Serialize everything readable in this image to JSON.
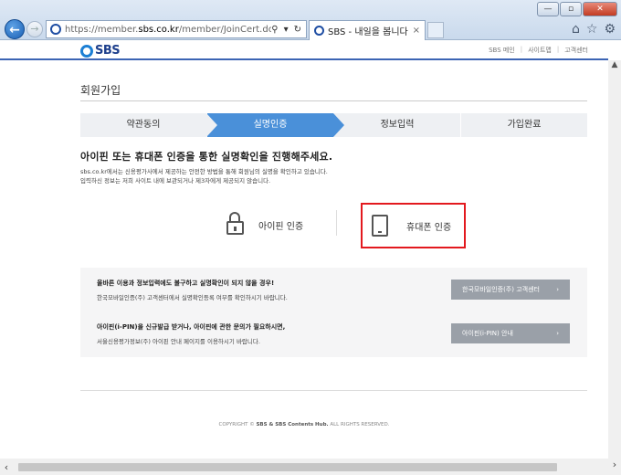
{
  "browser": {
    "url_prefix": "https://member.",
    "url_domain": "sbs.co.kr",
    "url_path": "/member/JoinCert.do",
    "tab_title": "SBS - 내일을 봅니다",
    "tab_close": "×",
    "search_symbol": "⚲",
    "dropdown_symbol": "▾",
    "refresh_symbol": "↻",
    "back_symbol": "←",
    "forward_symbol": "→",
    "home_symbol": "⌂",
    "star_symbol": "☆",
    "gear_symbol": "⚙",
    "minimize_symbol": "—",
    "maximize_symbol": "▫",
    "close_symbol": "✕"
  },
  "site": {
    "logo_text": "SBS",
    "links": [
      "SBS 메인",
      "사이트맵",
      "고객센터"
    ],
    "link_sep": "|"
  },
  "page": {
    "title": "회원가입",
    "steps": [
      "약관동의",
      "실명인증",
      "정보입력",
      "가입완료"
    ],
    "heading": "아이핀 또는 휴대폰 인증을 통한 실명확인을 진행해주세요.",
    "desc1": "sbs.co.kr에서는 신용평가사에서 제공하는 안전한 방법을 통해 회원님의 실명을 확인하고 있습니다.",
    "desc2": "입력하신 정보는 저희 사이트 내에 보관되거나 제3자에게 제공되지 않습니다.",
    "methods": {
      "ipin": "아이핀 인증",
      "phone": "휴대폰 인증"
    }
  },
  "info": {
    "row1_title": "올바른 이용과 정보입력에도 불구하고 실명확인이 되지 않을 경우!",
    "row1_text": "한국모바일인증(주) 고객센터에서 실명확인등록 여부를 확인하시기 바랍니다.",
    "row1_btn": "한국모바일인증(주) 고객센터",
    "row2_title": "아이핀(i-PIN)을 신규발급 받거나, 아이핀에 관한 문의가 필요하시면,",
    "row2_text": "서울신용평가정보(주) 아이핀 안내 페이지를 이용하시기 바랍니다.",
    "row2_btn": "아이핀(i-PIN) 안내",
    "btn_arrow": "›"
  },
  "footer": {
    "prefix": "COPYRIGHT © ",
    "brand": "SBS & SBS Contents Hub.",
    "suffix": " ALL RIGHTS RESERVED."
  },
  "scroll": {
    "left": "‹",
    "right": "›",
    "up": "▲"
  },
  "colors": {
    "accent": "#4a90d9",
    "highlight": "#e3191e",
    "button": "#9aa0a8"
  }
}
